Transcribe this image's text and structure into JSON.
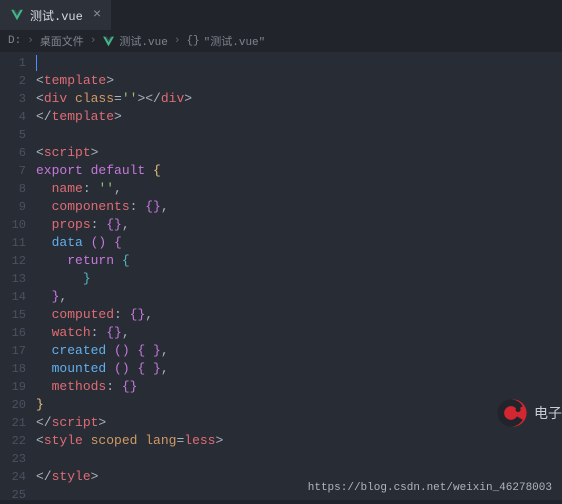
{
  "tab": {
    "label": "测试.vue"
  },
  "breadcrumbs": {
    "drive": "D:",
    "folder": "桌面文件",
    "file": "测试.vue",
    "symbol_braces": "{}",
    "symbol": "\"测试.vue\"",
    "sep": "›"
  },
  "lines": {
    "count": 25
  },
  "code": {
    "l2_open": "<",
    "l2_tag": "template",
    "l2_close": ">",
    "l3_open": "<",
    "l3_tag": "div",
    "l3_attr": " class",
    "l3_eq": "=",
    "l3_str": "''",
    "l3_mid": "></",
    "l3_tag2": "div",
    "l3_end": ">",
    "l4_open": "</",
    "l4_tag": "template",
    "l4_close": ">",
    "l6_open": "<",
    "l6_tag": "script",
    "l6_close": ">",
    "l7_kw1": "export",
    "l7_kw2": " default",
    "l7_brace": " {",
    "l8_prop": "name",
    "l8_colon": ": ",
    "l8_str": "''",
    "l8_comma": ",",
    "l9_prop": "components",
    "l9_colon": ": ",
    "l9_val": "{}",
    "l9_comma": ",",
    "l10_prop": "props",
    "l10_colon": ": ",
    "l10_val": "{}",
    "l10_comma": ",",
    "l11_fn": "data",
    "l11_paren": " () ",
    "l11_brace": "{",
    "l12_kw": "return",
    "l12_brace": " {",
    "l13_brace": "}",
    "l14_brace": "}",
    "l14_comma": ",",
    "l15_prop": "computed",
    "l15_colon": ": ",
    "l15_val": "{}",
    "l15_comma": ",",
    "l16_prop": "watch",
    "l16_colon": ": ",
    "l16_val": "{}",
    "l16_comma": ",",
    "l17_fn": "created",
    "l17_rest": " () { }",
    "l17_comma": ",",
    "l18_fn": "mounted",
    "l18_rest": " () { }",
    "l18_comma": ",",
    "l19_prop": "methods",
    "l19_colon": ": ",
    "l19_val": "{}",
    "l20_brace": "}",
    "l21_open": "</",
    "l21_tag": "script",
    "l21_close": ">",
    "l22_open": "<",
    "l22_tag": "style",
    "l22_attr1": " scoped",
    "l22_attr2": " lang",
    "l22_eq": "=",
    "l22_val": "less",
    "l22_close": ">",
    "l24_open": "</",
    "l24_tag": "style",
    "l24_close": ">"
  },
  "badge": {
    "text": "电子"
  },
  "watermark": "https://blog.csdn.net/weixin_46278003"
}
